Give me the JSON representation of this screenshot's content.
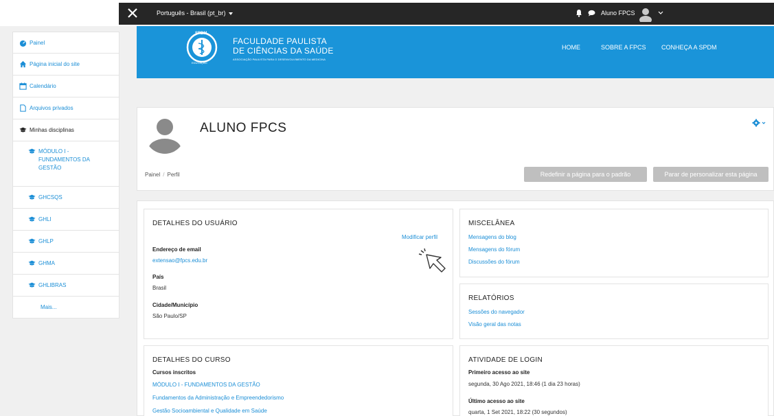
{
  "topbar": {
    "language": "Português - Brasil (pt_br)",
    "username": "Aluno FPCS",
    "icons": [
      "close-icon",
      "bell-icon",
      "chat-icon",
      "avatar-icon",
      "chevron-down-icon"
    ]
  },
  "sidebar": {
    "items": [
      {
        "label": "Painel",
        "icon": "dashboard-icon"
      },
      {
        "label": "Página inicial do site",
        "icon": "home-icon"
      },
      {
        "label": "Calendário",
        "icon": "calendar-icon"
      },
      {
        "label": "Arquivos privados",
        "icon": "file-icon"
      },
      {
        "label": "Minhas disciplinas",
        "icon": "graduation-cap-icon"
      },
      {
        "label": "MÓDULO I - FUNDAMENTOS DA GESTÃO",
        "icon": "graduation-cap-icon"
      },
      {
        "label": "GHCSQS",
        "icon": "graduation-cap-icon"
      },
      {
        "label": "GHLI",
        "icon": "graduation-cap-icon"
      },
      {
        "label": "GHLP",
        "icon": "graduation-cap-icon"
      },
      {
        "label": "GHMA",
        "icon": "graduation-cap-icon"
      },
      {
        "label": "GHLIBRAS",
        "icon": "graduation-cap-icon"
      },
      {
        "label": "Mais..."
      }
    ]
  },
  "banner": {
    "brand_line1": "FACULDADE PAULISTA",
    "brand_line2": "DE CIÊNCIAS DA SAÚDE",
    "brand_line3": "ASSOCIAÇÃO PAULISTA PARA O DESENVOLVIMENTO DA MEDICINA",
    "logo_top": "SPDM",
    "logo_bottom": "EDUCAÇÃO",
    "nav": [
      "HOME",
      "SOBRE A FPCS",
      "CONHEÇA A SPDM"
    ],
    "color": "#1a94d9"
  },
  "profile": {
    "name": "ALUNO FPCS",
    "breadcrumb": [
      "Painel",
      "Perfil"
    ],
    "reset_button": "Redefinir a página para o padrão",
    "stop_button": "Parar de personalizar esta página"
  },
  "user_details": {
    "title": "DETALHES DO USUÁRIO",
    "edit_link": "Modificar perfil",
    "email_label": "Endereço de email",
    "email": "extensao@fpcs.edu.br",
    "country_label": "País",
    "country": "Brasil",
    "city_label": "Cidade/Município",
    "city": "São Paulo/SP"
  },
  "misc": {
    "title": "MISCELÂNEA",
    "links": [
      "Mensagens do blog",
      "Mensagens do fórum",
      "Discussões do fórum"
    ]
  },
  "reports": {
    "title": "RELATÓRIOS",
    "links": [
      "Sessões do navegador",
      "Visão geral das notas"
    ]
  },
  "course_details": {
    "title": "DETALHES DO CURSO",
    "enrolled_label": "Cursos inscritos",
    "courses": [
      "MÓDULO I - FUNDAMENTOS DA GESTÃO",
      "Fundamentos da Administração e Empreendedorismo",
      "Gestão Socioambiental e Qualidade em Saúde"
    ]
  },
  "login_activity": {
    "title": "ATIVIDADE DE LOGIN",
    "first_label": "Primeiro acesso ao site",
    "first_value": "segunda, 30 Ago 2021, 18:46  (1 dia 23 horas)",
    "last_label": "Último acesso ao site",
    "last_value": "quarta, 1 Set 2021, 18:22  (30 segundos)"
  },
  "colors": {
    "link": "#1b8ed6",
    "topbar": "#262626",
    "button_disabled": "#bfbfbf"
  }
}
